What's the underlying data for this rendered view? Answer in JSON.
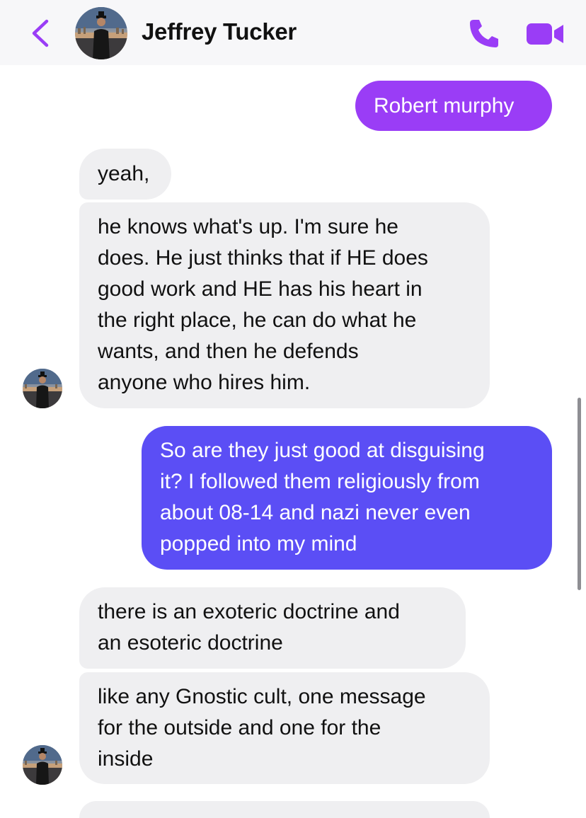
{
  "header": {
    "contact_name": "Jeffrey Tucker",
    "back_icon": "chevron-left-icon",
    "call_icon": "phone-icon",
    "video_icon": "video-camera-icon",
    "accent_color": "#9a3df6"
  },
  "messages": [
    {
      "direction": "outgoing",
      "text": "Robert murphy"
    },
    {
      "direction": "incoming",
      "text": "yeah,"
    },
    {
      "direction": "incoming",
      "text": "he knows what's up. I'm sure he\ndoes. He just thinks that if HE does\ngood work and HE has his heart in\nthe right place, he can do what he\nwants, and then he defends\nanyone who hires him."
    },
    {
      "direction": "outgoing",
      "text": "So are they just good at disguising\nit? I followed them religiously from\nabout 08-14 and nazi never even\npopped into my mind"
    },
    {
      "direction": "incoming",
      "text": "there is an exoteric doctrine and\nan esoteric doctrine"
    },
    {
      "direction": "incoming",
      "text": "like any Gnostic cult, one message\nfor the outside and one for the\ninside"
    }
  ],
  "colors": {
    "incoming_bubble": "#efeff1",
    "outgoing_bubble_top": "#9a3df6",
    "outgoing_bubble_lower": "#5b4ef5"
  }
}
